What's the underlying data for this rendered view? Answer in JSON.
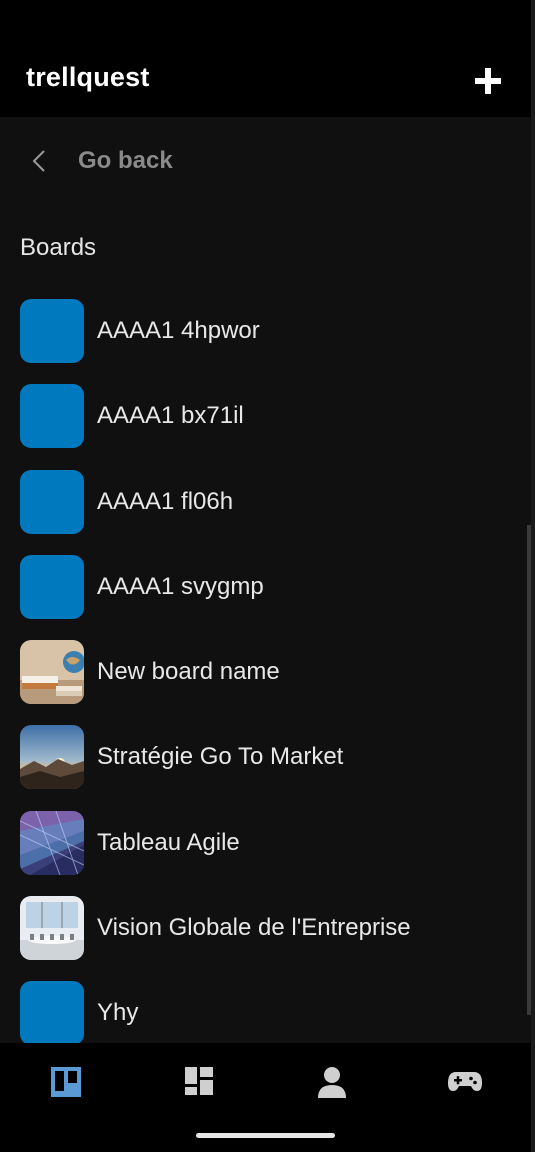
{
  "header": {
    "app_title": "trellquest",
    "add_icon": "plus-icon"
  },
  "navigation": {
    "back_label": "Go back",
    "back_icon": "chevron-left-icon"
  },
  "boards_section": {
    "title": "Boards",
    "items": [
      {
        "name": "AAAA1 4hpwor",
        "thumbnail": "solid",
        "color": "#0079bf"
      },
      {
        "name": "AAAA1 bx71il",
        "thumbnail": "solid",
        "color": "#0079bf"
      },
      {
        "name": "AAAA1 fl06h",
        "thumbnail": "solid",
        "color": "#0079bf"
      },
      {
        "name": "AAAA1 svygmp",
        "thumbnail": "solid",
        "color": "#0079bf"
      },
      {
        "name": "New board name",
        "thumbnail": "photo-books-globe"
      },
      {
        "name": "Stratégie Go To Market",
        "thumbnail": "photo-mountain-sunrise"
      },
      {
        "name": "Tableau Agile",
        "thumbnail": "photo-geometric-pattern"
      },
      {
        "name": "Vision Globale de l'Entreprise",
        "thumbnail": "photo-meeting-room"
      },
      {
        "name": "Yhy",
        "thumbnail": "solid",
        "color": "#0079bf"
      }
    ]
  },
  "bottom_nav": {
    "items": [
      {
        "icon": "boards-icon",
        "active": true
      },
      {
        "icon": "dashboard-icon",
        "active": false
      },
      {
        "icon": "user-icon",
        "active": false
      },
      {
        "icon": "gamepad-icon",
        "active": false
      }
    ]
  },
  "colors": {
    "accent": "#0079bf",
    "active_nav": "#5b9bd5",
    "inactive_nav": "#cfcfcf",
    "background": "#101010",
    "bar_background": "#000000"
  }
}
